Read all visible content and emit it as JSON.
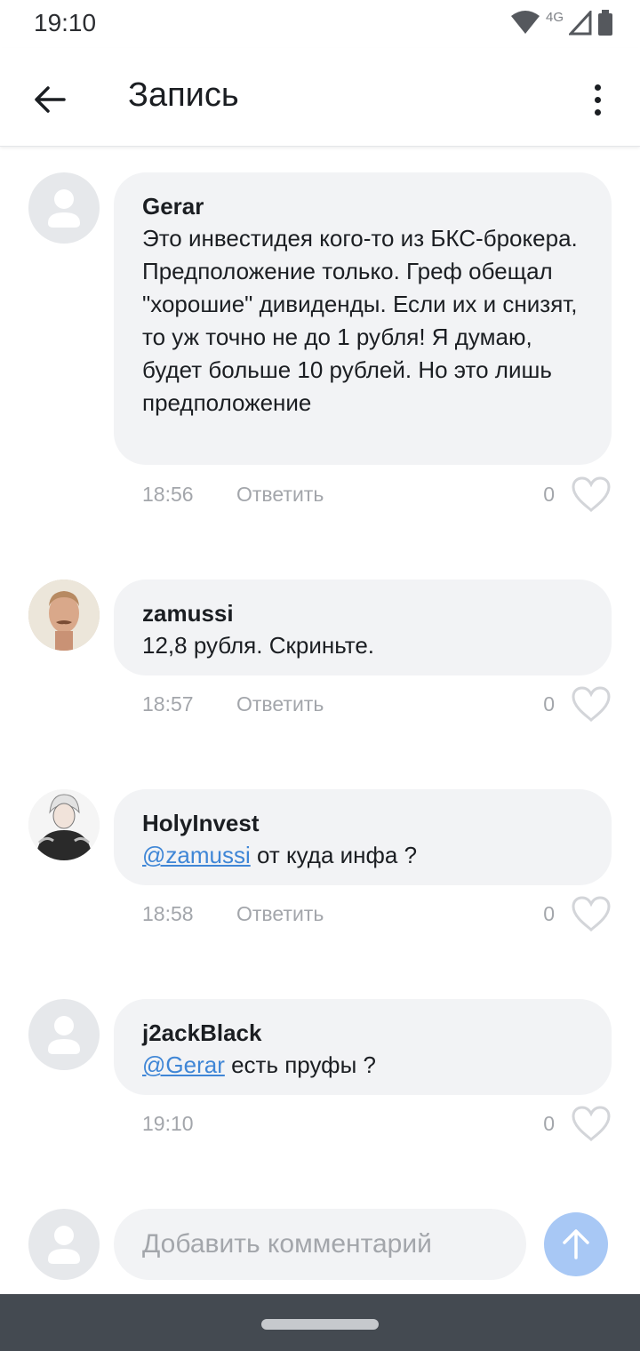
{
  "status_bar": {
    "time": "19:10",
    "network": "4G"
  },
  "header": {
    "title": "Запись"
  },
  "comments": [
    {
      "author": "Gerar",
      "text": "Это инвестидея кого-то из БКС-брокера. Предположение только. Греф обещал \"хорошие\" дивиденды. Если их и снизят, то уж точно не до 1 рубля! Я думаю, будет больше 10 рублей. Но это лишь предположение",
      "time": "18:56",
      "reply_label": "Ответить",
      "likes": "0"
    },
    {
      "author": "zamussi",
      "text": "12,8 рубля. Скриньте.",
      "time": "18:57",
      "reply_label": "Ответить",
      "likes": "0"
    },
    {
      "author": "HolyInvest",
      "mention": "@zamussi",
      "text": " от куда инфа ?",
      "time": "18:58",
      "reply_label": "Ответить",
      "likes": "0"
    },
    {
      "author": "j2ackBlack",
      "mention": "@Gerar",
      "text": " есть пруфы ?",
      "time": "19:10",
      "likes": "0"
    }
  ],
  "composer": {
    "placeholder": "Добавить комментарий"
  },
  "colors": {
    "accent": "#3f86d6",
    "bubble": "#f2f3f5",
    "send_button": "#a8c8f5",
    "muted_text": "#a3a6ab"
  }
}
